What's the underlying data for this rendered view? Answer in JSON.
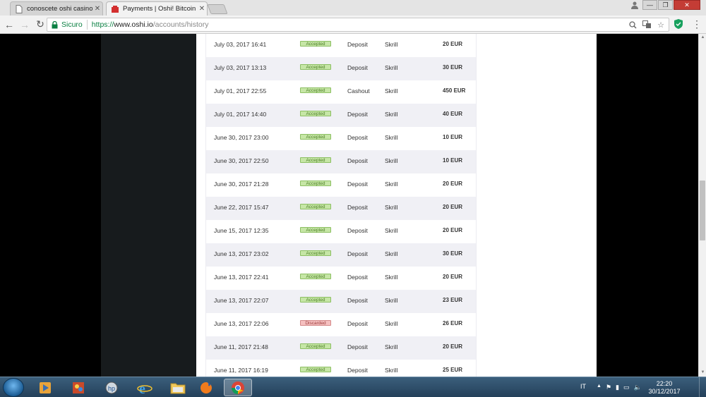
{
  "browser": {
    "tabs": [
      {
        "title": "conoscete oshi casino? - ",
        "active": false
      },
      {
        "title": "Payments | Oshi! Bitcoin",
        "active": true
      }
    ],
    "secure_label": "Sicuro",
    "url": {
      "scheme": "https://",
      "host": "www.oshi.io",
      "path": "/accounts/history"
    }
  },
  "transactions": [
    {
      "date": "July 03, 2017 16:41",
      "status": "Accepted",
      "status_type": "accepted",
      "type": "Deposit",
      "method": "Skrill",
      "amount": "20 EUR"
    },
    {
      "date": "July 03, 2017 13:13",
      "status": "Accepted",
      "status_type": "accepted",
      "type": "Deposit",
      "method": "Skrill",
      "amount": "30 EUR"
    },
    {
      "date": "July 01, 2017 22:55",
      "status": "Accepted",
      "status_type": "accepted",
      "type": "Cashout",
      "method": "Skrill",
      "amount": "450 EUR"
    },
    {
      "date": "July 01, 2017 14:40",
      "status": "Accepted",
      "status_type": "accepted",
      "type": "Deposit",
      "method": "Skrill",
      "amount": "40 EUR"
    },
    {
      "date": "June 30, 2017 23:00",
      "status": "Accepted",
      "status_type": "accepted",
      "type": "Deposit",
      "method": "Skrill",
      "amount": "10 EUR"
    },
    {
      "date": "June 30, 2017 22:50",
      "status": "Accepted",
      "status_type": "accepted",
      "type": "Deposit",
      "method": "Skrill",
      "amount": "10 EUR"
    },
    {
      "date": "June 30, 2017 21:28",
      "status": "Accepted",
      "status_type": "accepted",
      "type": "Deposit",
      "method": "Skrill",
      "amount": "20 EUR"
    },
    {
      "date": "June 22, 2017 15:47",
      "status": "Accepted",
      "status_type": "accepted",
      "type": "Deposit",
      "method": "Skrill",
      "amount": "20 EUR"
    },
    {
      "date": "June 15, 2017 12:35",
      "status": "Accepted",
      "status_type": "accepted",
      "type": "Deposit",
      "method": "Skrill",
      "amount": "20 EUR"
    },
    {
      "date": "June 13, 2017 23:02",
      "status": "Accepted",
      "status_type": "accepted",
      "type": "Deposit",
      "method": "Skrill",
      "amount": "30 EUR"
    },
    {
      "date": "June 13, 2017 22:41",
      "status": "Accepted",
      "status_type": "accepted",
      "type": "Deposit",
      "method": "Skrill",
      "amount": "20 EUR"
    },
    {
      "date": "June 13, 2017 22:07",
      "status": "Accepted",
      "status_type": "accepted",
      "type": "Deposit",
      "method": "Skrill",
      "amount": "23 EUR"
    },
    {
      "date": "June 13, 2017 22:06",
      "status": "Discarded",
      "status_type": "discarded",
      "type": "Deposit",
      "method": "Skrill",
      "amount": "26 EUR"
    },
    {
      "date": "June 11, 2017 21:48",
      "status": "Accepted",
      "status_type": "accepted",
      "type": "Deposit",
      "method": "Skrill",
      "amount": "20 EUR"
    },
    {
      "date": "June 11, 2017 16:19",
      "status": "Accepted",
      "status_type": "accepted",
      "type": "Deposit",
      "method": "Skrill",
      "amount": "25 EUR"
    }
  ],
  "colors": {
    "accepted_bg": "#c6e6a6",
    "discarded_bg": "#f5c0c0",
    "secure_green": "#0b8043",
    "sidebar_dark": "#171b1d",
    "row_alt": "#f0f0f5"
  },
  "taskbar": {
    "apps": [
      "start-orb",
      "media-center-icon",
      "paint-icon",
      "hp-icon",
      "internet-explorer-icon",
      "file-explorer-icon",
      "firefox-icon",
      "chrome-icon"
    ],
    "language": "IT",
    "time": "22:20",
    "date": "30/12/2017"
  }
}
